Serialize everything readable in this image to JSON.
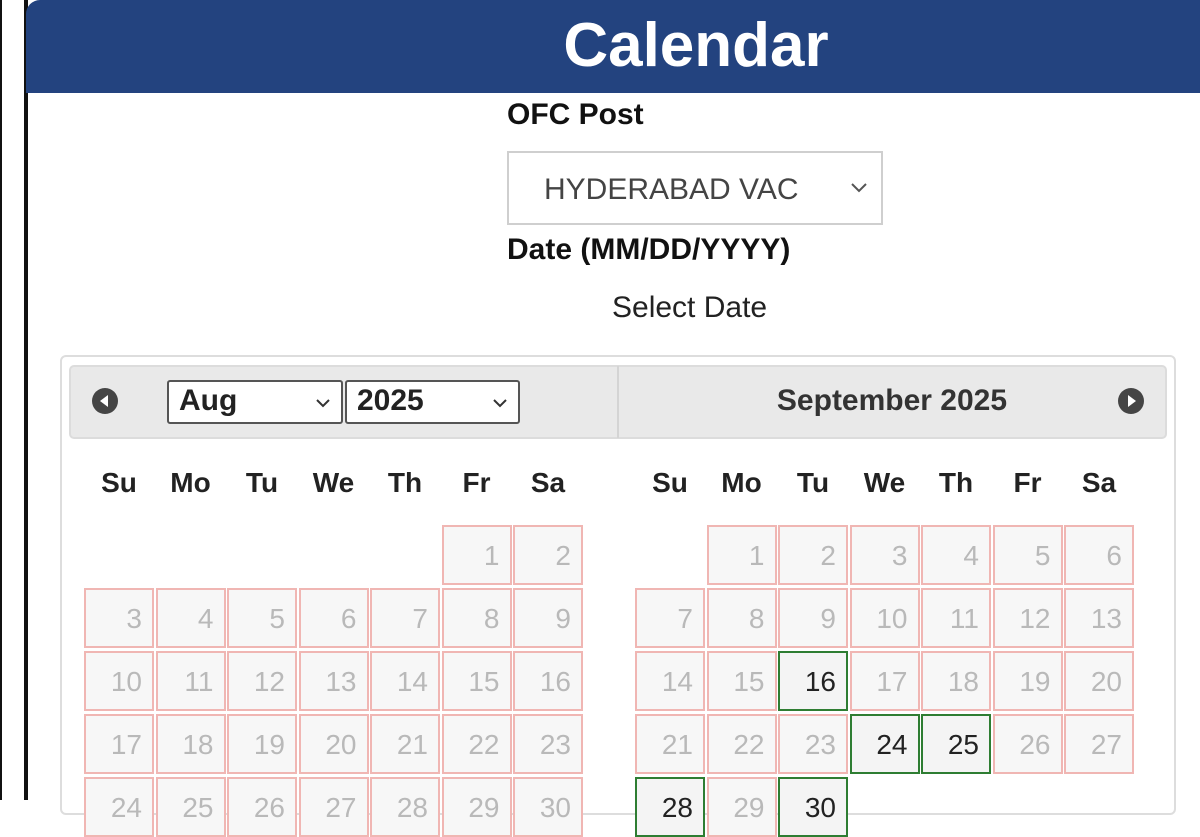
{
  "header": {
    "title": "Calendar"
  },
  "form": {
    "ofc_label": "OFC Post",
    "post_value": "HYDERABAD VAC",
    "date_label": "Date (MM/DD/YYYY)",
    "select_date_text": "Select Date"
  },
  "datepicker": {
    "month_value": "Aug",
    "year_value": "2025",
    "right_title": "September 2025",
    "weekdays": [
      "Su",
      "Mo",
      "Tu",
      "We",
      "Th",
      "Fr",
      "Sa"
    ],
    "left_month": {
      "rows": [
        [
          "",
          "",
          "",
          "",
          "",
          "1",
          "2"
        ],
        [
          "3",
          "4",
          "5",
          "6",
          "7",
          "8",
          "9"
        ],
        [
          "10",
          "11",
          "12",
          "13",
          "14",
          "15",
          "16"
        ],
        [
          "17",
          "18",
          "19",
          "20",
          "21",
          "22",
          "23"
        ],
        [
          "24",
          "25",
          "26",
          "27",
          "28",
          "29",
          "30"
        ]
      ],
      "available": []
    },
    "right_month": {
      "rows": [
        [
          "",
          "1",
          "2",
          "3",
          "4",
          "5",
          "6"
        ],
        [
          "7",
          "8",
          "9",
          "10",
          "11",
          "12",
          "13"
        ],
        [
          "14",
          "15",
          "16",
          "17",
          "18",
          "19",
          "20"
        ],
        [
          "21",
          "22",
          "23",
          "24",
          "25",
          "26",
          "27"
        ],
        [
          "28",
          "29",
          "30",
          "",
          "",
          "",
          ""
        ]
      ],
      "available": [
        "16",
        "24",
        "25",
        "28",
        "30"
      ]
    }
  },
  "colors": {
    "header_bg": "#23437f",
    "available_border": "#2e7d32",
    "unavailable_border": "#f0b6b3"
  },
  "icons": {
    "prev": "circle-triangle-left-icon",
    "next": "circle-triangle-right-icon",
    "dropdown": "chevron-down-icon"
  }
}
